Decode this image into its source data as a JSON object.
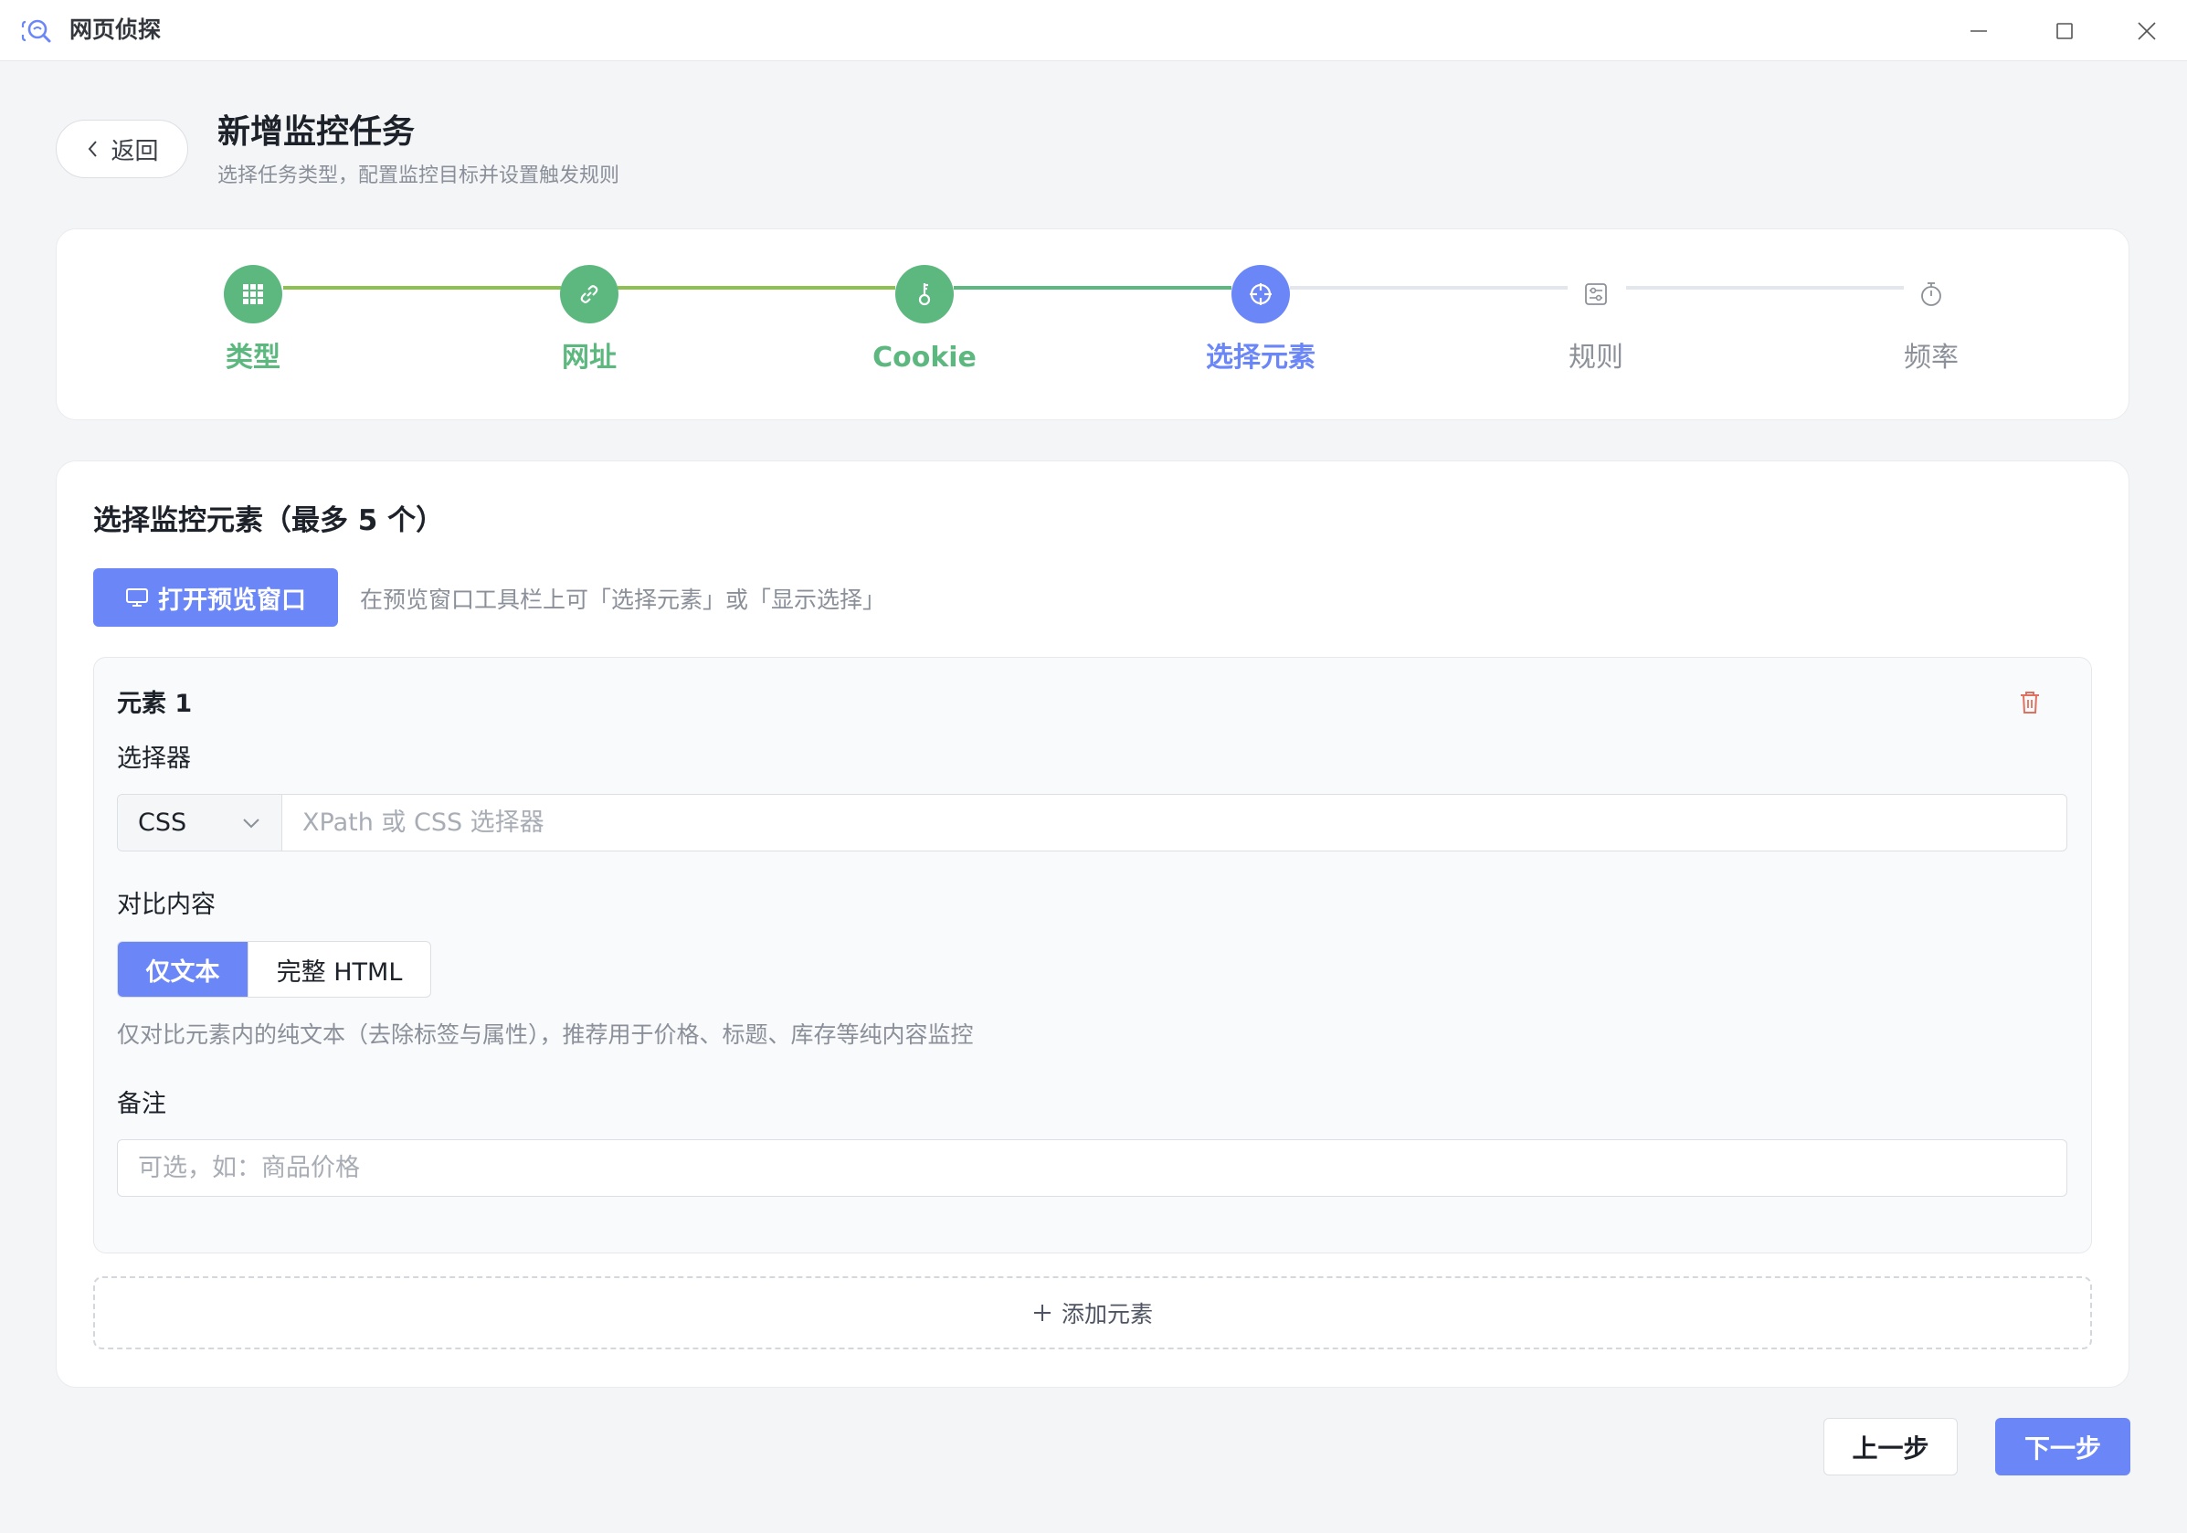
{
  "app": {
    "title": "网页侦探",
    "icon": "magnifier-app-icon"
  },
  "window_controls": [
    "minimize-icon",
    "maximize-icon",
    "close-icon"
  ],
  "header": {
    "back_label": "返回",
    "title": "新增监控任务",
    "subtitle": "选择任务类型，配置监控目标并设置触发规则"
  },
  "stepper": {
    "steps": [
      {
        "label": "类型",
        "state": "done",
        "icon": "grid-icon"
      },
      {
        "label": "网址",
        "state": "done",
        "icon": "link-icon"
      },
      {
        "label": "Cookie",
        "state": "done",
        "icon": "key-icon"
      },
      {
        "label": "选择元素",
        "state": "active",
        "icon": "crosshair-icon"
      },
      {
        "label": "规则",
        "state": "pending",
        "icon": "sliders-icon"
      },
      {
        "label": "频率",
        "state": "pending",
        "icon": "stopwatch-icon"
      }
    ],
    "colors": {
      "done": "#5cb87f",
      "active": "#6b86f7",
      "pending": "#8c9199"
    }
  },
  "main": {
    "section_title": "选择监控元素（最多 5 个）",
    "preview_button": "打开预览窗口",
    "preview_hint": "在预览窗口工具栏上可「选择元素」或「显示选择」",
    "element": {
      "title": "元素 1",
      "selector_label": "选择器",
      "selector_type": "CSS",
      "selector_placeholder": "XPath 或 CSS 选择器",
      "selector_value": "",
      "compare_label": "对比内容",
      "compare_options": [
        "仅文本",
        "完整 HTML"
      ],
      "compare_selected": "仅文本",
      "compare_hint": "仅对比元素内的纯文本（去除标签与属性），推荐用于价格、标题、库存等纯内容监控",
      "note_label": "备注",
      "note_placeholder": "可选，如：商品价格",
      "note_value": ""
    },
    "add_element": "添加元素"
  },
  "footer": {
    "prev": "上一步",
    "next": "下一步"
  },
  "accent_color": "#6b86f7",
  "danger_color": "#e0705f"
}
